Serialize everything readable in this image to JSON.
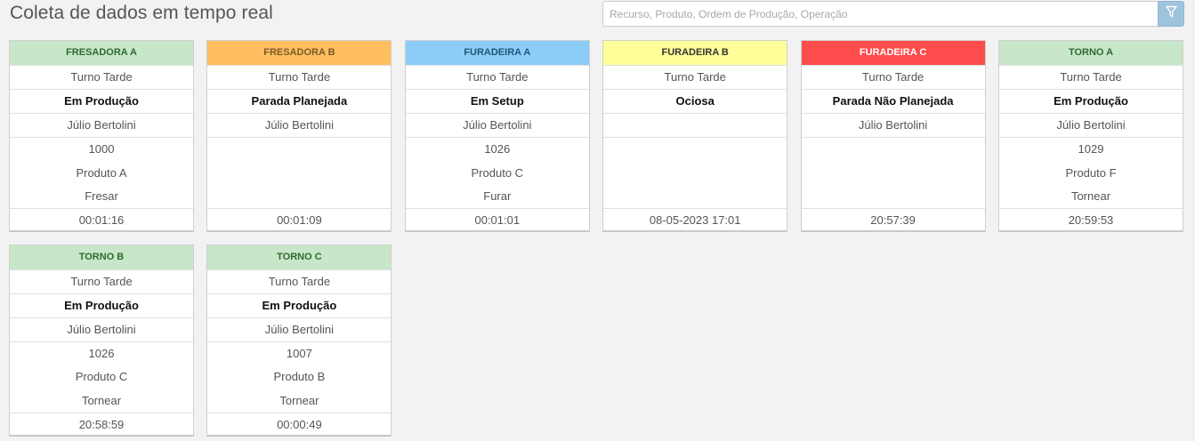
{
  "header": {
    "title": "Coleta de dados em tempo real",
    "search_placeholder": "Recurso, Produto, Ordem de Produção, Operação"
  },
  "icons": {
    "filter": "filter-icon"
  },
  "colors": {
    "green_bg": "#c8e6c9",
    "green_text": "#2e6b30",
    "orange_bg": "#ffbf5e",
    "orange_text": "#7a5a2a",
    "blue_bg": "#8ccdf8",
    "blue_text": "#21567a",
    "yellow_bg": "#ffff99",
    "yellow_text": "#333333",
    "red_bg": "#ff4d4d",
    "red_text": "#ffffff",
    "filter_button": "#9ec3dc"
  },
  "cards": [
    {
      "name": "FRESADORA A",
      "color": "green",
      "shift": "Turno Tarde",
      "status": "Em Produção",
      "operator": "Júlio Bertolini",
      "order": "1000",
      "product": "Produto A",
      "operation": "Fresar",
      "time": "00:01:16"
    },
    {
      "name": "FRESADORA B",
      "color": "orange",
      "shift": "Turno Tarde",
      "status": "Parada Planejada",
      "operator": "Júlio Bertolini",
      "order": "",
      "product": "",
      "operation": "",
      "time": "00:01:09"
    },
    {
      "name": "FURADEIRA A",
      "color": "blue",
      "shift": "Turno Tarde",
      "status": "Em Setup",
      "operator": "Júlio Bertolini",
      "order": "1026",
      "product": "Produto C",
      "operation": "Furar",
      "time": "00:01:01"
    },
    {
      "name": "FURADEIRA B",
      "color": "yellow",
      "shift": "Turno Tarde",
      "status": "Ociosa",
      "operator": "",
      "order": "",
      "product": "",
      "operation": "",
      "time": "08-05-2023 17:01"
    },
    {
      "name": "FURADEIRA C",
      "color": "red",
      "shift": "Turno Tarde",
      "status": "Parada Não Planejada",
      "operator": "Júlio Bertolini",
      "order": "",
      "product": "",
      "operation": "",
      "time": "20:57:39"
    },
    {
      "name": "TORNO A",
      "color": "green",
      "shift": "Turno Tarde",
      "status": "Em Produção",
      "operator": "Júlio Bertolini",
      "order": "1029",
      "product": "Produto F",
      "operation": "Tornear",
      "time": "20:59:53"
    },
    {
      "name": "TORNO B",
      "color": "green",
      "shift": "Turno Tarde",
      "status": "Em Produção",
      "operator": "Júlio Bertolini",
      "order": "1026",
      "product": "Produto C",
      "operation": "Tornear",
      "time": "20:58:59"
    },
    {
      "name": "TORNO C",
      "color": "green",
      "shift": "Turno Tarde",
      "status": "Em Produção",
      "operator": "Júlio Bertolini",
      "order": "1007",
      "product": "Produto B",
      "operation": "Tornear",
      "time": "00:00:49"
    }
  ]
}
